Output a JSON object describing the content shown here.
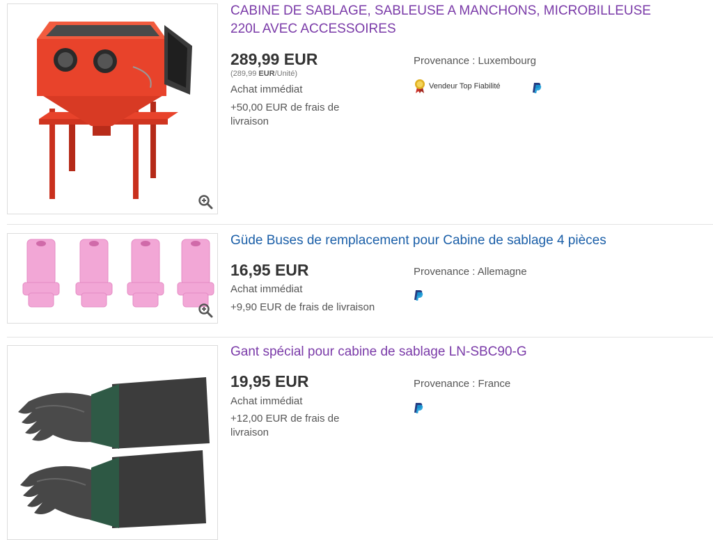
{
  "colors": {
    "visited_link": "#7a3aa8",
    "link": "#1b5fa8",
    "paypal_dark": "#253b80",
    "paypal_light": "#179bd7",
    "product_red": "#e23a24"
  },
  "results": [
    {
      "title_line1": "CABINE DE SABLAGE, SABLEUSE A MANCHONS, MICROBILLEUSE",
      "title_line2": "220L AVEC ACCESSOIRES",
      "price": "289,99 EUR",
      "unit_price_prefix": "(289,99 ",
      "unit_price_bold": "EUR",
      "unit_price_suffix": "/Unité)",
      "buy_format": "Achat immédiat",
      "shipping_line1": "+50,00 EUR de frais de",
      "shipping_line2": "livraison",
      "origin": "Provenance : Luxembourg",
      "top_seller": "Vendeur Top Fiabilité",
      "icons": [
        "sandblasting-cabinet",
        "zoom-icon",
        "top-seller-icon",
        "paypal-icon"
      ]
    },
    {
      "title": "Güde Buses de remplacement pour Cabine de sablage 4 pièces",
      "price": "16,95 EUR",
      "buy_format": "Achat immédiat",
      "shipping": "+9,90 EUR de frais de livraison",
      "origin": "Provenance : Allemagne",
      "icons": [
        "ceramic-nozzles",
        "zoom-icon",
        "paypal-icon"
      ]
    },
    {
      "title": "Gant spécial pour cabine de sablage LN-SBC90-G",
      "price": "19,95 EUR",
      "buy_format": "Achat immédiat",
      "shipping_line1": "+12,00 EUR de frais de",
      "shipping_line2": "livraison",
      "origin": "Provenance : France",
      "icons": [
        "rubber-gloves",
        "paypal-icon"
      ]
    }
  ]
}
